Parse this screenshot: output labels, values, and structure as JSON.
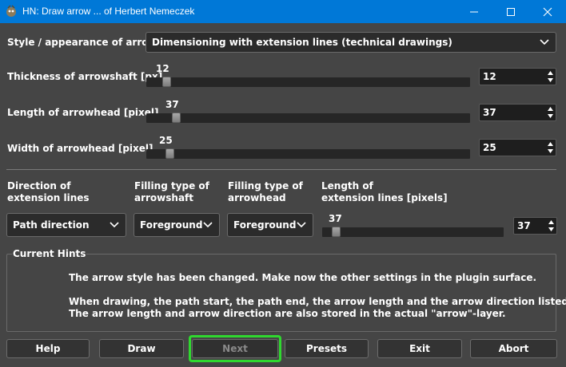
{
  "window": {
    "title": "HN: Draw arrow ... of Herbert Nemeczek"
  },
  "style": {
    "label": "Style / appearance of arrow",
    "value": "Dimensioning with extension lines (technical drawings)"
  },
  "thickness": {
    "label": "Thickness of arrowshaft [px]",
    "slider_value": "12",
    "spin_value": "12",
    "fraction": 0.03
  },
  "head_length": {
    "label": "Length of arrowhead [pixel]",
    "slider_value": "37",
    "spin_value": "37",
    "fraction": 0.06
  },
  "head_width": {
    "label": "Width of arrowhead [pixel]",
    "slider_value": "25",
    "spin_value": "25",
    "fraction": 0.04
  },
  "direction": {
    "label_line1": "Direction of",
    "label_line2": "extension lines",
    "value": "Path direction"
  },
  "fill_shaft": {
    "label_line1": "Filling type of",
    "label_line2": "arrowshaft",
    "value": "Foreground"
  },
  "fill_head": {
    "label_line1": "Filling type of",
    "label_line2": "arrowhead",
    "value": "Foreground"
  },
  "ext_length": {
    "label_line1": "Length of",
    "label_line2": "extension lines [pixels]",
    "slider_value": "37",
    "spin_value": "37",
    "fraction": 0.02
  },
  "hints": {
    "title": "Current Hints",
    "line1": "The arrow style has been changed. Make now the other settings in the plugin surface.",
    "line2": "When drawing, the path start, the path end, the arrow length and the arrow direction listed out.",
    "line3": "The arrow length and arrow direction are also stored in the actual \"arrow\"-layer."
  },
  "buttons": {
    "help": "Help",
    "draw": "Draw",
    "next": "Next",
    "presets": "Presets",
    "exit": "Exit",
    "abort": "Abort"
  },
  "colors": {
    "titlebar": "#0078d7",
    "background": "#454545",
    "focus": "#2fd82f"
  },
  "icons": {
    "app": "gimp-icon",
    "minimize": "minimize-icon",
    "maximize": "maximize-icon",
    "close": "close-icon",
    "dropdown": "chevron-down-icon"
  }
}
